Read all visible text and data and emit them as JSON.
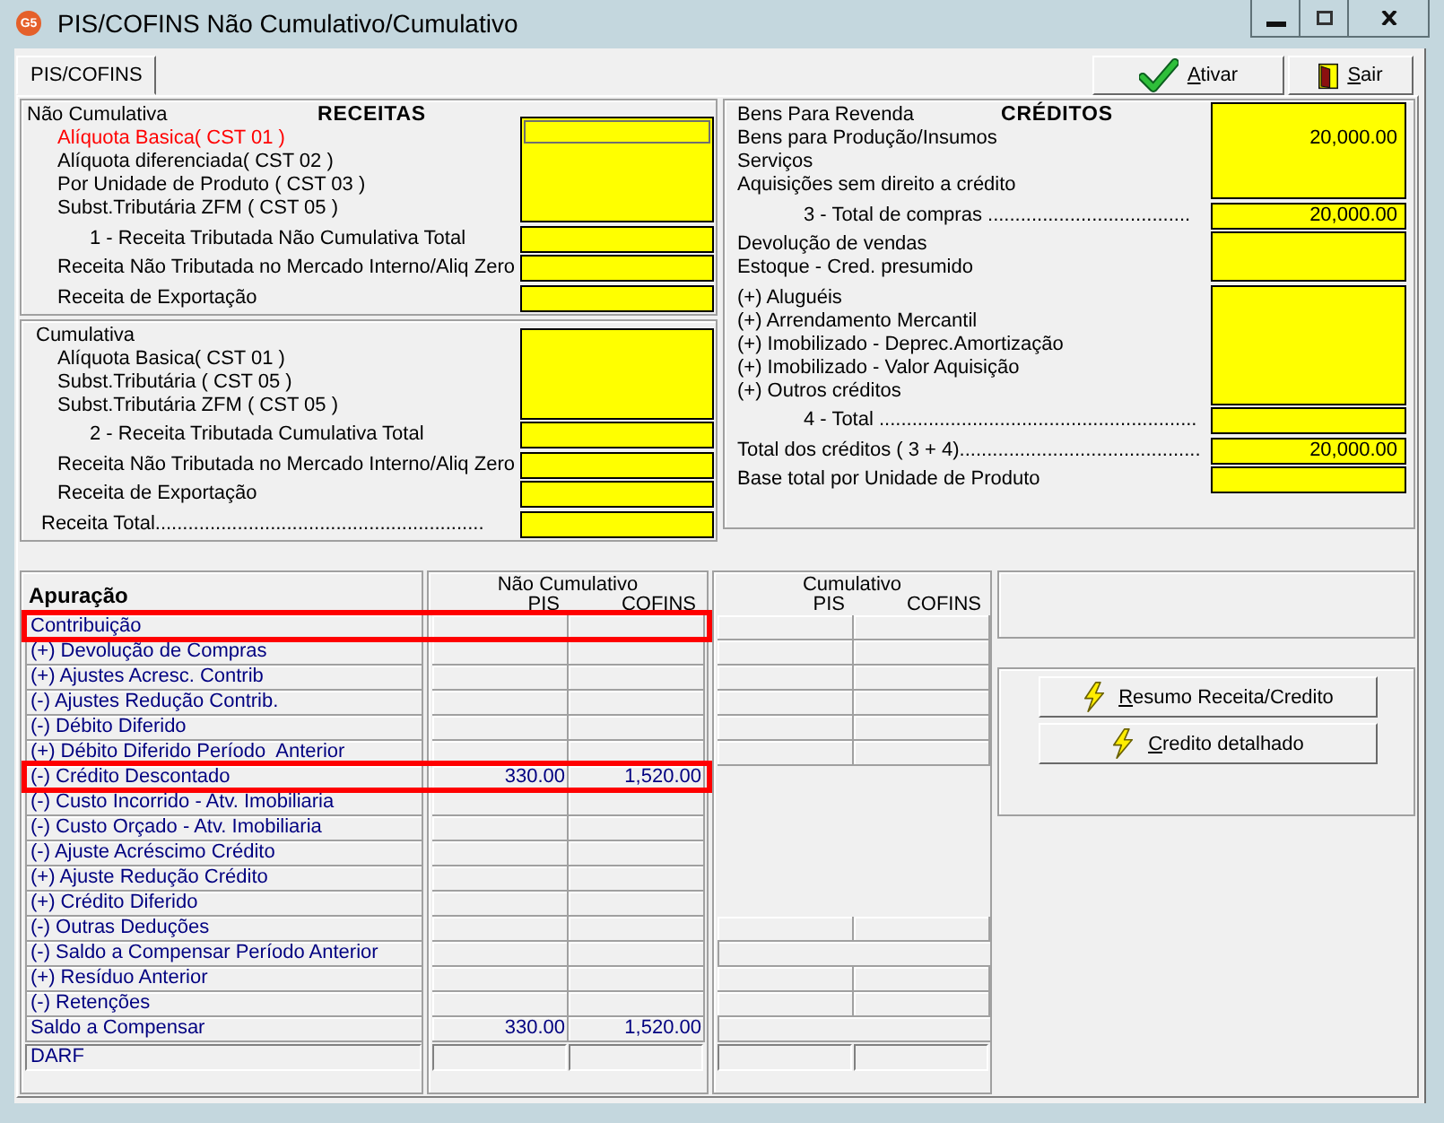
{
  "window": {
    "title": "PIS/COFINS Não Cumulativo/Cumulativo",
    "logo_text": "G5"
  },
  "tabs": [
    {
      "label": "PIS/COFINS",
      "selected": true
    }
  ],
  "toolbar": [
    {
      "label": "Ativar",
      "kind": "activate"
    },
    {
      "label": "Sair",
      "kind": "exit"
    }
  ],
  "receitas": {
    "heading": "RECEITAS",
    "sections": [
      {
        "title": "Não Cumulativa",
        "groups": [
          {
            "lines": [
              {
                "label": "Alíquota Basica( CST 01 )",
                "kind": "item",
                "selected": true
              },
              {
                "label": "Alíquota diferenciada( CST 02 )",
                "kind": "item",
                "selected": false
              },
              {
                "label": "Por Unidade de Produto ( CST 03 )",
                "kind": "item",
                "selected": false
              },
              {
                "label": "Subst.Tributária ZFM ( CST 05 )",
                "kind": "item",
                "selected": false
              }
            ]
          },
          {
            "lines": [
              {
                "label": "1 - Receita Tributada Não Cumulativa Total",
                "kind": "subtotal",
                "selected": false
              }
            ]
          },
          {
            "lines": [
              {
                "label": "Receita Não Tributada no Mercado Interno/Aliq Zero",
                "kind": "item",
                "selected": false
              }
            ]
          },
          {
            "lines": [
              {
                "label": "Receita de Exportação",
                "kind": "item",
                "selected": false
              }
            ]
          }
        ]
      },
      {
        "title": "Cumulativa",
        "groups": [
          {
            "lines": [
              {
                "label": "Alíquota Basica( CST 01 )",
                "kind": "item",
                "selected": false
              },
              {
                "label": "Subst.Tributária ( CST 05 )",
                "kind": "item",
                "selected": false
              },
              {
                "label": "Subst.Tributária ZFM ( CST 05 )",
                "kind": "item",
                "selected": false
              }
            ]
          },
          {
            "lines": [
              {
                "label": "2 - Receita Tributada Cumulativa Total",
                "kind": "subtotal",
                "selected": false
              }
            ]
          },
          {
            "lines": [
              {
                "label": "Receita Não Tributada no Mercado Interno/Aliq Zero",
                "kind": "item",
                "selected": false
              }
            ]
          },
          {
            "lines": [
              {
                "label": "Receita de Exportação",
                "kind": "item",
                "selected": false
              }
            ]
          },
          {
            "lines": [
              {
                "label": "Receita Total............................................................",
                "kind": "total",
                "selected": false
              }
            ]
          }
        ]
      }
    ]
  },
  "creditos": {
    "heading": "CRÉDITOS",
    "groups": [
      {
        "lines": [
          {
            "label": "Bens Para Revenda",
            "kind": "item"
          },
          {
            "label": "Bens para Produção/Insumos",
            "kind": "item",
            "value": "20,000.00"
          },
          {
            "label": "Serviços",
            "kind": "item"
          },
          {
            "label": "Aquisições sem direito a crédito",
            "kind": "item"
          }
        ]
      },
      {
        "lines": [
          {
            "label": "3 - Total de compras .....................................",
            "kind": "subtotal",
            "value": "20,000.00"
          }
        ]
      },
      {
        "lines": [
          {
            "label": "Devolução de vendas",
            "kind": "item"
          },
          {
            "label": "Estoque - Cred. presumido",
            "kind": "item"
          }
        ]
      },
      {
        "lines": [
          {
            "label": "(+) Aluguéis",
            "kind": "item"
          },
          {
            "label": "(+) Arrendamento Mercantil",
            "kind": "item"
          },
          {
            "label": "(+) Imobilizado - Deprec.Amortização",
            "kind": "item"
          },
          {
            "label": "(+) Imobilizado - Valor Aquisição",
            "kind": "item"
          },
          {
            "label": "(+) Outros créditos",
            "kind": "item"
          }
        ]
      },
      {
        "lines": [
          {
            "label": "4 - Total ..........................................................",
            "kind": "subtotal"
          }
        ]
      },
      {
        "lines": [
          {
            "label": "Total dos créditos ( 3 + 4)............................................",
            "kind": "item",
            "value": "20,000.00"
          }
        ]
      },
      {
        "lines": [
          {
            "label": "Base total por Unidade de Produto",
            "kind": "item"
          }
        ]
      }
    ]
  },
  "apuracao": {
    "title": "Apuração",
    "groups": [
      {
        "title": "Não Cumulativo",
        "columns": [
          "PIS",
          "COFINS"
        ]
      },
      {
        "title": "Cumulativo",
        "columns": [
          "PIS",
          "COFINS"
        ]
      }
    ],
    "rows": [
      {
        "label": "Contribuição",
        "highlighted": true,
        "kind": "split"
      },
      {
        "label": "(+) Devolução de Compras",
        "highlighted": false,
        "kind": "split"
      },
      {
        "label": "(+) Ajustes Acresc. Contrib",
        "highlighted": false,
        "kind": "split"
      },
      {
        "label": "(-) Ajustes Redução Contrib.",
        "highlighted": false,
        "kind": "split"
      },
      {
        "label": "(-) Débito Diferido",
        "highlighted": false,
        "kind": "split"
      },
      {
        "label": "(+) Débito Diferido Período  Anterior",
        "highlighted": false,
        "kind": "split"
      },
      {
        "label": "(-) Crédito Descontado",
        "highlighted": true,
        "values": [
          "330.00",
          "1,520.00"
        ],
        "kind": "blank"
      },
      {
        "label": "(-) Custo Incorrido - Atv. Imobiliaria",
        "highlighted": false,
        "kind": "blank"
      },
      {
        "label": "(-) Custo Orçado - Atv. Imobiliaria",
        "highlighted": false,
        "kind": "blank"
      },
      {
        "label": "(-) Ajuste Acréscimo Crédito",
        "highlighted": false,
        "kind": "blank"
      },
      {
        "label": "(+) Ajuste Redução Crédito",
        "highlighted": false,
        "kind": "blank"
      },
      {
        "label": "(+) Crédito Diferido",
        "highlighted": false,
        "kind": "blank"
      },
      {
        "label": "(-) Outras Deduções",
        "highlighted": false,
        "kind": "split"
      },
      {
        "label": "(-) Saldo a Compensar Período Anterior",
        "highlighted": false,
        "kind": "merged"
      },
      {
        "label": "(+) Resíduo Anterior",
        "highlighted": false,
        "kind": "split"
      },
      {
        "label": "(-) Retenções",
        "highlighted": false,
        "kind": "split"
      },
      {
        "label": "Saldo a Compensar",
        "highlighted": false,
        "values": [
          "330.00",
          "1,520.00"
        ],
        "kind": "merged"
      }
    ],
    "darf": {
      "label": "DARF"
    }
  },
  "actions": [
    {
      "label": "Resumo Receita/Credito"
    },
    {
      "label": "Credito detalhado"
    }
  ]
}
